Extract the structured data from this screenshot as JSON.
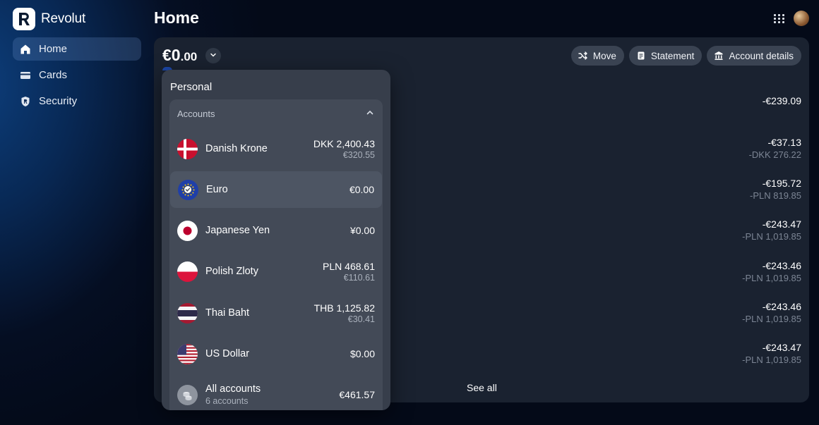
{
  "brand": {
    "name": "Revolut"
  },
  "sidebar": {
    "items": [
      {
        "label": "Home",
        "icon": "home-icon"
      },
      {
        "label": "Cards",
        "icon": "card-icon"
      },
      {
        "label": "Security",
        "icon": "shield-icon"
      }
    ]
  },
  "header": {
    "title": "Home"
  },
  "balance": {
    "whole": "€0",
    "decimals": ".00"
  },
  "actions": {
    "move": "Move",
    "statement": "Statement",
    "account_details": "Account details"
  },
  "transactions": [
    {
      "amount": "-€239.09",
      "sub": ""
    },
    {
      "amount": "-€37.13",
      "sub": "-DKK 276.22"
    },
    {
      "amount": "-€195.72",
      "sub": "-PLN 819.85"
    },
    {
      "amount": "-€243.47",
      "sub": "-PLN 1,019.85"
    },
    {
      "amount": "-€243.46",
      "sub": "-PLN 1,019.85"
    },
    {
      "amount": "-€243.46",
      "sub": "-PLN 1,019.85"
    },
    {
      "amount": "-€243.47",
      "sub": "-PLN 1,019.85"
    }
  ],
  "see_all": "See all",
  "dropdown": {
    "title": "Personal",
    "section": "Accounts",
    "accounts": [
      {
        "name": "Danish Krone",
        "value": "DKK 2,400.43",
        "converted": "€320.55",
        "flag": "dk"
      },
      {
        "name": "Euro",
        "value": "€0.00",
        "converted": "",
        "flag": "eu",
        "selected": true
      },
      {
        "name": "Japanese Yen",
        "value": "¥0.00",
        "converted": "",
        "flag": "jp"
      },
      {
        "name": "Polish Zloty",
        "value": "PLN 468.61",
        "converted": "€110.61",
        "flag": "pl"
      },
      {
        "name": "Thai Baht",
        "value": "THB 1,125.82",
        "converted": "€30.41",
        "flag": "th"
      },
      {
        "name": "US Dollar",
        "value": "$0.00",
        "converted": "",
        "flag": "us"
      }
    ],
    "all": {
      "name": "All accounts",
      "count": "6 accounts",
      "value": "€461.57"
    }
  },
  "colors": {
    "background": "#040a18",
    "card": "#1a2230",
    "dropdown": "#373e4b",
    "accent": "#1c47a8"
  }
}
